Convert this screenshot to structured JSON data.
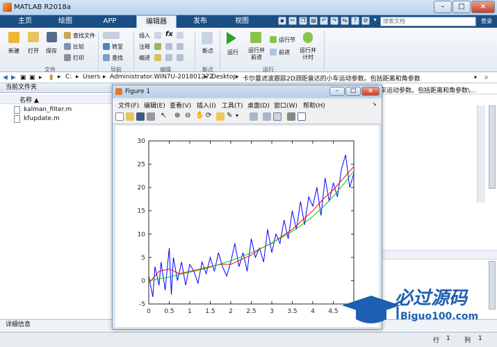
{
  "window": {
    "title": "MATLAB R2018a",
    "min": "–",
    "max": "□",
    "close": "×"
  },
  "tabs": [
    {
      "label": "主页"
    },
    {
      "label": "绘图"
    },
    {
      "label": "APP"
    },
    {
      "label": "编辑器"
    },
    {
      "label": "发布"
    },
    {
      "label": "视图"
    }
  ],
  "search": {
    "placeholder": "搜索文档",
    "button": "登录"
  },
  "ribbon": {
    "file": {
      "new": "新建",
      "open": "打开",
      "save": "保存",
      "find_files": "查找文件",
      "compare": "比较",
      "print": "打印",
      "label": "文件"
    },
    "nav": {
      "goto": "转至",
      "find": "查找",
      "label": "导航"
    },
    "edit": {
      "insert": "插入",
      "comment": "注释",
      "indent": "缩进",
      "fx": "fx",
      "label": "编辑"
    },
    "breakpoints": {
      "btn": "断点",
      "label": "断点"
    },
    "run": {
      "run": "运行",
      "run_advance": "运行并\n前进",
      "run_section": "运行节",
      "advance": "前进",
      "run_time": "运行并\n计时",
      "label": "运行"
    }
  },
  "address": {
    "parts": [
      "C:",
      "Users",
      "Administrator.WIN7U-20180127Z",
      "Desktop",
      "卡尔曼滤波跟踪2D测距雷达的小车运动参数。包括距离和角参数"
    ]
  },
  "current_folder": {
    "title": "当前文件夹",
    "column": "名称 ▲",
    "files": [
      "kalman_filter.m",
      "kfupdate.m"
    ]
  },
  "right_panel": {
    "text": "车运动参数。包括距离和角参数\\..."
  },
  "details": {
    "label": "详细信息"
  },
  "status": {
    "row_label": "行",
    "row": "1",
    "col_label": "列",
    "col": "1"
  },
  "figure": {
    "title": "Figure 1",
    "menu": [
      "文件(F)",
      "编辑(E)",
      "查看(V)",
      "插入(I)",
      "工具(T)",
      "桌面(D)",
      "窗口(W)",
      "帮助(H)"
    ]
  },
  "watermark": {
    "cn": "必过源码",
    "en": "Biguo100.com"
  },
  "colors": {
    "tabbar": "#1a4f86",
    "noisy": "#0000ff",
    "kalman": "#ff0000",
    "true": "#00cc00"
  },
  "chart_data": {
    "type": "line",
    "xlim": [
      0,
      5
    ],
    "ylim": [
      -5,
      30
    ],
    "xticks": [
      "0",
      "0.5",
      "1",
      "1.5",
      "2",
      "2.5",
      "3",
      "3.5",
      "4",
      "4.5"
    ],
    "yticks": [
      "-5",
      "0",
      "5",
      "10",
      "15",
      "20",
      "25",
      "30"
    ],
    "series": [
      {
        "color": "#0000ff",
        "x": [
          0,
          0.1,
          0.15,
          0.25,
          0.3,
          0.4,
          0.5,
          0.55,
          0.6,
          0.7,
          0.8,
          0.9,
          1.0,
          1.1,
          1.2,
          1.3,
          1.4,
          1.5,
          1.6,
          1.7,
          1.8,
          1.9,
          2.0,
          2.1,
          2.2,
          2.3,
          2.4,
          2.5,
          2.6,
          2.7,
          2.8,
          2.9,
          3.0,
          3.1,
          3.2,
          3.3,
          3.4,
          3.5,
          3.6,
          3.7,
          3.8,
          3.9,
          4.0,
          4.1,
          4.2,
          4.3,
          4.4,
          4.5,
          4.6,
          4.7,
          4.8,
          4.9,
          5.0
        ],
        "y": [
          1,
          -3.5,
          3,
          -1,
          4,
          -2,
          7,
          -3,
          5,
          0,
          4,
          -1,
          3.5,
          2,
          -0.5,
          4,
          1.5,
          5,
          2,
          6,
          3,
          1,
          4,
          8,
          3,
          6,
          2,
          9,
          5,
          7,
          4,
          11,
          6,
          10,
          8,
          13,
          9,
          15,
          11,
          17,
          12,
          18,
          16,
          20,
          14,
          22,
          17,
          21,
          18,
          24,
          27,
          20,
          23
        ]
      },
      {
        "color": "#ff0000",
        "x": [
          0,
          0.25,
          0.5,
          0.75,
          1.0,
          1.25,
          1.5,
          1.75,
          2.0,
          2.25,
          2.5,
          2.75,
          3.0,
          3.25,
          3.5,
          3.75,
          4.0,
          4.25,
          4.5,
          4.75,
          5.0
        ],
        "y": [
          -0.5,
          2,
          2.5,
          1.5,
          2,
          2.5,
          3,
          3.5,
          3.5,
          4.5,
          5.5,
          7,
          8,
          9.5,
          11,
          13,
          15,
          17.5,
          19.5,
          22,
          24.5
        ]
      },
      {
        "color": "#00cc00",
        "x": [
          0,
          0.25,
          0.5,
          0.75,
          1.0,
          1.25,
          1.5,
          1.75,
          2.0,
          2.25,
          2.5,
          2.75,
          3.0,
          3.25,
          3.5,
          3.75,
          4.0,
          4.25,
          4.5,
          4.75,
          5.0
        ],
        "y": [
          0,
          0.4,
          0.8,
          1.3,
          1.8,
          2.3,
          2.9,
          3.6,
          4.3,
          5.1,
          6.0,
          7.0,
          8.1,
          9.3,
          10.6,
          12.1,
          13.8,
          15.8,
          18.1,
          20.7,
          23.5
        ]
      }
    ]
  }
}
